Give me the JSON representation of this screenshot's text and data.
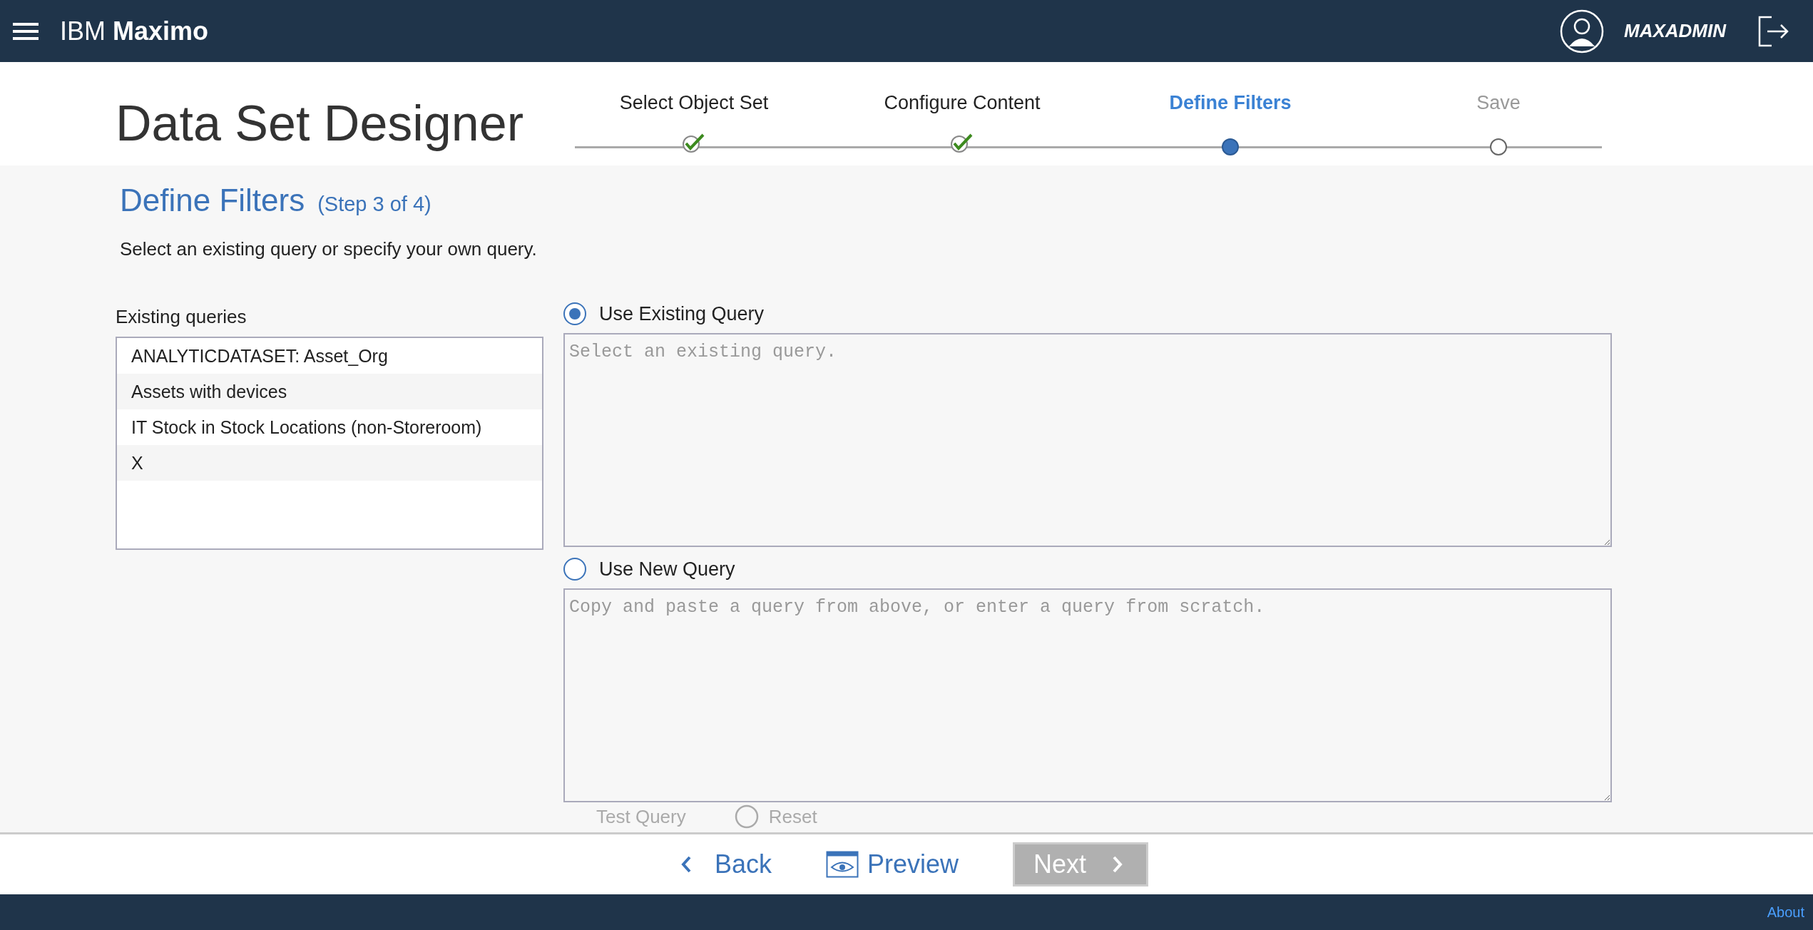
{
  "app_bar": {
    "brand_prefix": "IBM",
    "brand_name": "Maximo",
    "user": "MAXADMIN"
  },
  "header": {
    "title": "Data Set Designer",
    "steps": [
      {
        "label": "Select Object Set",
        "completed": true,
        "selected": false
      },
      {
        "label": "Configure Content",
        "completed": true,
        "selected": false
      },
      {
        "label": "Define Filters",
        "completed": false,
        "selected": true
      },
      {
        "label": "Save",
        "completed": false,
        "selected": false
      }
    ]
  },
  "section": {
    "title": "Define Filters",
    "step_note": "(Step 3 of 4)",
    "description": "Select an existing query or specify your own query."
  },
  "existing_queries": {
    "label": "Existing queries",
    "items": [
      {
        "label": "ANALYTICDATASET: Asset_Org",
        "selected": false
      },
      {
        "label": "Assets with devices",
        "selected": false
      },
      {
        "label": "IT Stock in Stock Locations (non-Storeroom)",
        "selected": false
      },
      {
        "label": "X",
        "selected": false
      }
    ]
  },
  "query_options": [
    {
      "label": "Use Existing Query",
      "selected": true,
      "placeholder": "Select an existing query."
    },
    {
      "label": "Use New Query",
      "selected": false,
      "placeholder": "Copy and paste a query from above, or enter a query from scratch."
    }
  ],
  "query_actions": {
    "test": "Test Query",
    "reset": "Reset"
  },
  "footer_nav": {
    "back": "Back",
    "preview": "Preview",
    "next": "Next",
    "next_disabled": true
  },
  "bottom_bar": {
    "about": "About"
  }
}
